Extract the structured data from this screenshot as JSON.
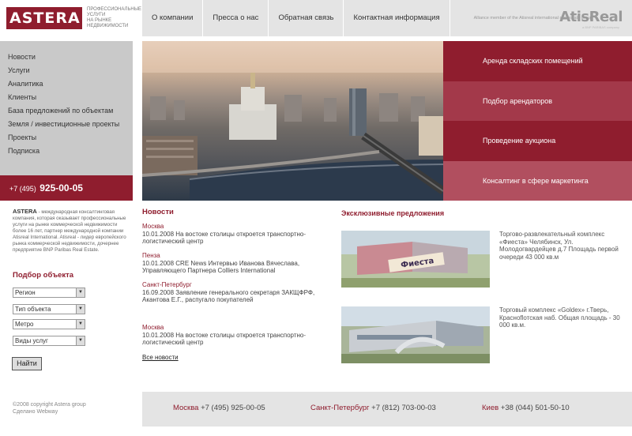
{
  "brand": {
    "logo": "ASTERA",
    "tagline": [
      "ПРОФЕССИОНАЛЬНЫЕ",
      "УСЛУГИ",
      "НА РЫНКЕ",
      "НЕДВИЖИМОСТИ"
    ],
    "partner_logo": "AtisReal",
    "partner_logo_sub": "a BNP PARIBAS company"
  },
  "topnav": {
    "items": [
      "О компании",
      "Пресса о нас",
      "Обратная связь",
      "Контактная информация"
    ],
    "alliance": "Alliance member of the Atisreal international real estate group"
  },
  "sidebar": {
    "items": [
      "Новости",
      "Услуги",
      "Аналитика",
      "Клиенты",
      "База предложений по объектам",
      "Земля / инвестиционные проекты",
      "Проекты",
      "Подписка"
    ],
    "phone_prefix": "+7 (495)",
    "phone_number": "925-00-05"
  },
  "about": {
    "brand": "ASTERA",
    "text": " - международная консалтинговая компания, которая оказывает профессиональные услуги на рынке коммерческой недвижимости более 16 лет, партнер международной компании Atisreal International.  Atisreal - лидер европейского рынка коммерческой недвижимости, дочернее предприятие BNP Paribas Real Estate."
  },
  "search": {
    "title": "Подбор объекта",
    "selects": [
      "Регион",
      "Тип объекта",
      "Метро",
      "Виды услуг"
    ],
    "button": "Найти"
  },
  "promo": {
    "items": [
      "Аренда складских помещений",
      "Подбор арендаторов",
      "Проведение аукциона",
      "Консалтинг в сфере маркетинга"
    ],
    "colors": [
      "#8f1d2e",
      "#a3394a",
      "#8f1d2e",
      "#b14f5f"
    ]
  },
  "news": {
    "title": "Новости",
    "items": [
      {
        "city": "Москва",
        "text": "10.01.2008 На востоке столицы откроется транспортно-логистический центр"
      },
      {
        "city": "Пенза",
        "text": "10.01.2008 CRE News Интервью Иванова Вячеслава, Управляющего Партнера Colliers International"
      },
      {
        "city": "Санкт-Петербург",
        "text": "16.09.2008 Заявление генерального секретаря ЗАКЩФРФ, Акантова Е.Г., распугало покупателей"
      },
      {
        "city": "Москва",
        "text": "10.01.2008 На востоке столицы откроется транспортно-логистический центр"
      }
    ],
    "all_link": "Все новости"
  },
  "offers": {
    "title": "Эксклюзивные предложения",
    "items": [
      {
        "text": "Торгово-развлекательный комплекс «Фиеста» Челябинск, Ул. Молодогвардейцев д.7 Площадь первой очереди 43 000 кв.м",
        "sign": "Фиеста"
      },
      {
        "text": "Торговый комплекс «Goldex» г.Тверь, Красноflотская наб. Общая площадь - 30 000 кв.м.",
        "sign": ""
      }
    ]
  },
  "footer": {
    "copyright": "©2008 copyright  Astera group",
    "made_by": "Сделано Webway",
    "offices": [
      {
        "city": "Москва",
        "phone": "+7 (495) 925-00-05"
      },
      {
        "city": "Санкт-Петербург",
        "phone": "+7 (812) 703-00-03"
      },
      {
        "city": "Киев",
        "phone": "+38 (044) 501-50-10"
      }
    ]
  }
}
